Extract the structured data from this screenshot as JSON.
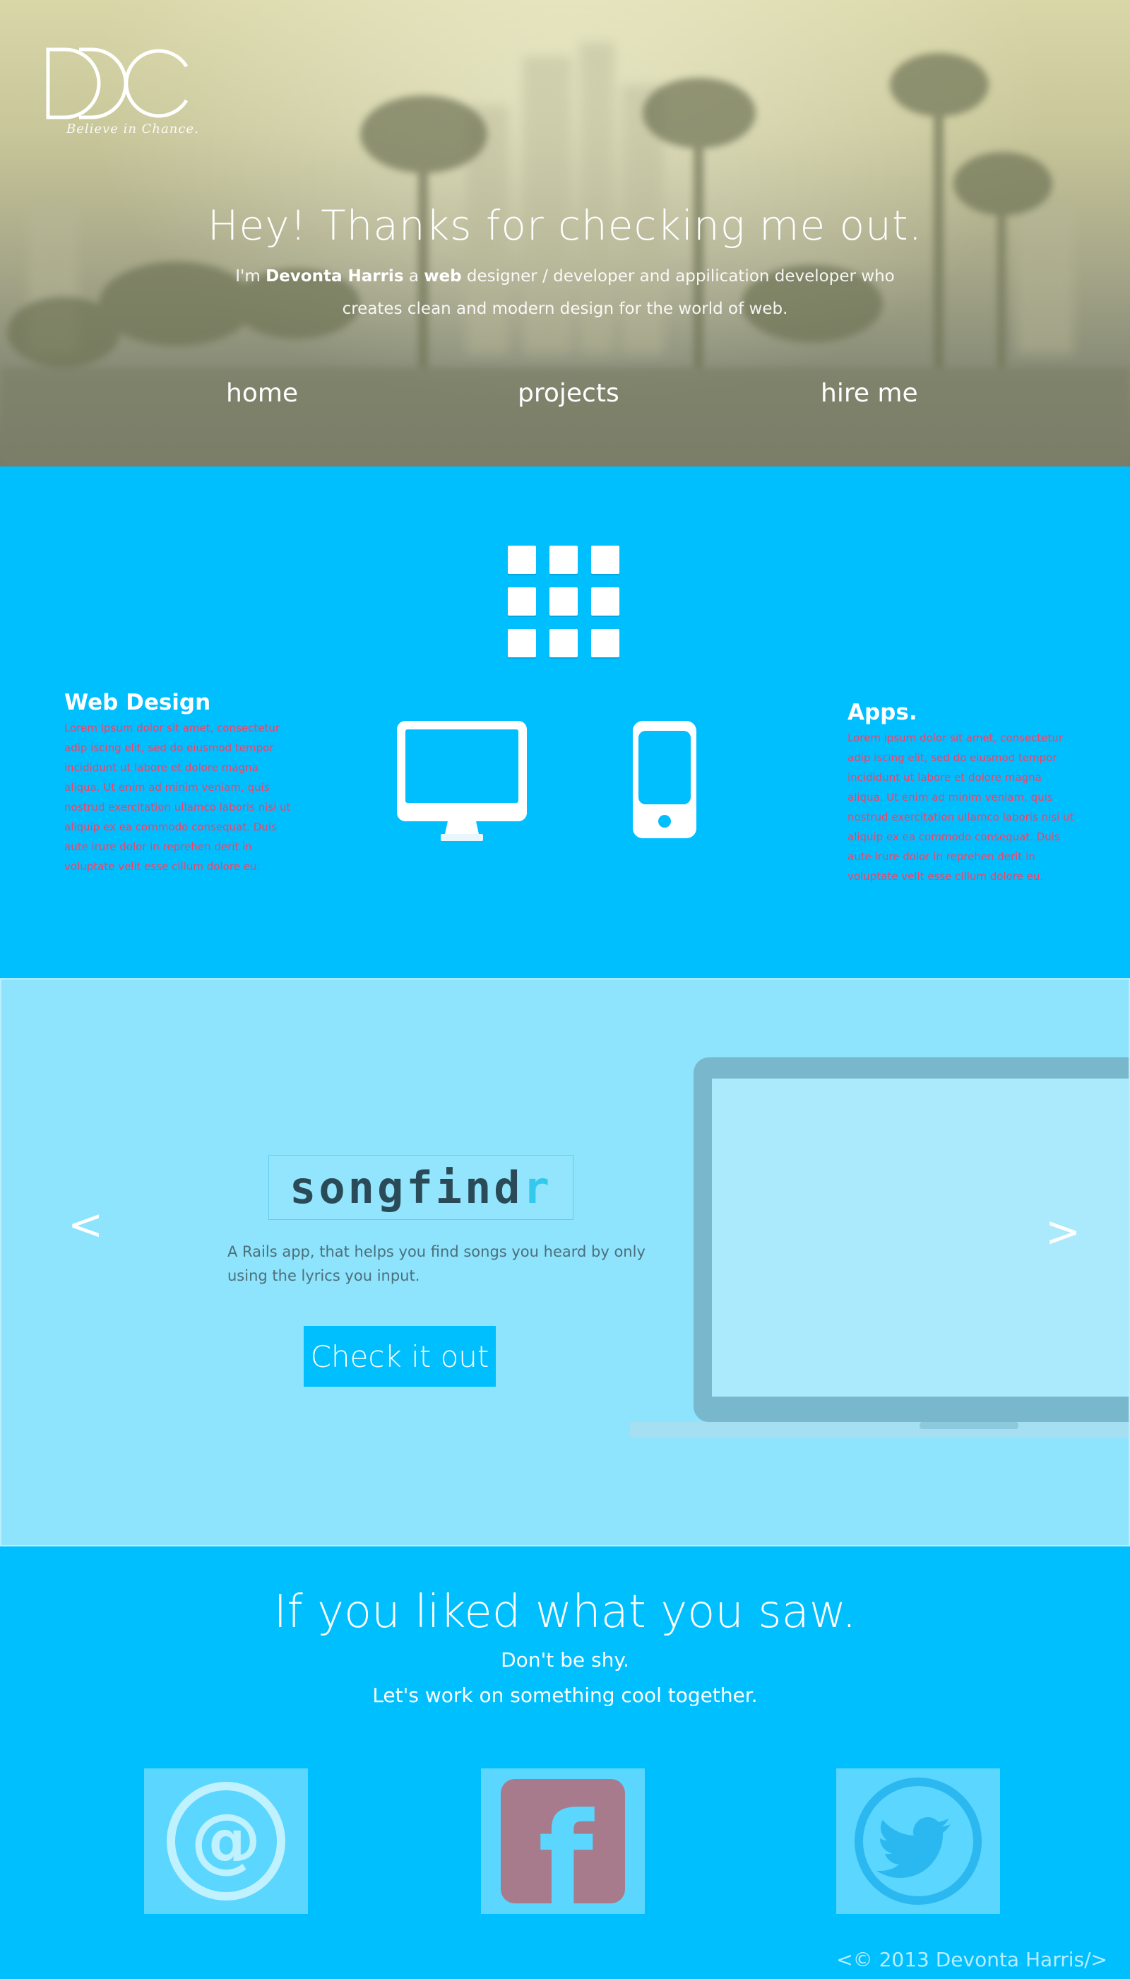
{
  "hero": {
    "logo_tagline": "Believe in Chance.",
    "title": "Hey! Thanks for checking me out.",
    "intro_prefix": "I'm ",
    "intro_name": "Devonta Harris",
    "intro_mid": " a ",
    "intro_role": "web",
    "intro_rest": " designer / developer and appilication developer who creates clean and modern design for the world of web.",
    "nav": [
      {
        "label": "home"
      },
      {
        "label": "projects"
      },
      {
        "label": "hire me"
      }
    ]
  },
  "services": {
    "web_design": {
      "title": "Web Design",
      "body": "Lorem ipsum dolor sit amet, consectetur adip iscing elit, sed do eiusmod tempor incididunt ut labore et dolore magna aliqua. Ut enim ad minim veniam, quis nostrud exercitation ullamco laboris nisi ut aliquip ex ea commodo consequat. Duis aute irure dolor in reprehen derit in voluptate velit esse cillum dolore eu."
    },
    "apps": {
      "title": "Apps.",
      "body": "Lorem ipsum dolor sit amet, consectetur adip iscing elit, sed do eiusmod tempor incididunt ut labore et dolore magna aliqua. Ut enim ad minim veniam, quis nostrud exercitation ullamco laboris nisi ut aliquip ex ea commodo consequat. Duis aute irure dolor in reprehen derit in voluptate velit esse cillum dolore eu."
    }
  },
  "project": {
    "name_main": "songfind",
    "name_accent": "r",
    "description": "A Rails app, that helps you find songs you heard by only using the lyrics you input.",
    "cta_label": "Check it out",
    "prev_label": "<",
    "next_label": ">"
  },
  "contact": {
    "heading": "If you liked what you saw.",
    "line1": "Don't be shy.",
    "line2": "Let's work on something cool together.",
    "email_glyph": "@",
    "facebook_glyph": "f"
  },
  "footer": {
    "copyright": "<© 2013 Devonta Harris/>"
  },
  "colors": {
    "primary": "#00bfff",
    "project_bg": "#8ee4fd",
    "lorem_text": "#ff3b5c",
    "facebook_tile": "#a77b8c"
  }
}
